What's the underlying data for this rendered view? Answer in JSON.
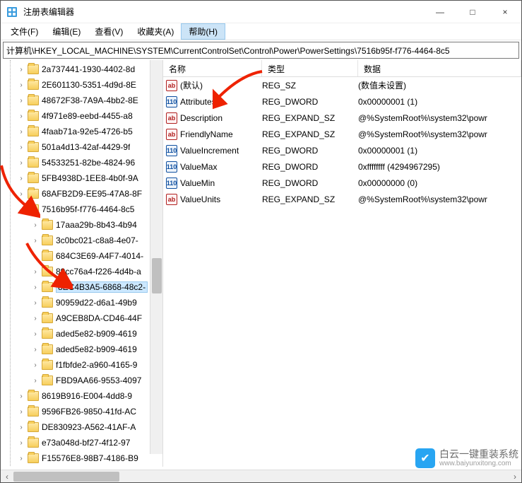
{
  "window": {
    "title": "注册表编辑器",
    "minimize": "—",
    "maximize": "□",
    "close": "×"
  },
  "menu": {
    "file": "文件(F)",
    "edit": "编辑(E)",
    "view": "查看(V)",
    "favorites": "收藏夹(A)",
    "help": "帮助(H)"
  },
  "address": "计算机\\HKEY_LOCAL_MACHINE\\SYSTEM\\CurrentControlSet\\Control\\Power\\PowerSettings\\7516b95f-f776-4464-8c5",
  "tree": {
    "level1": [
      "2a737441-1930-4402-8d",
      "2E601130-5351-4d9d-8E",
      "48672F38-7A9A-4bb2-8E",
      "4f971e89-eebd-4455-a8",
      "4faab71a-92e5-4726-b5",
      "501a4d13-42af-4429-9f",
      "54533251-82be-4824-96",
      "5FB4938D-1EE8-4b0f-9A",
      "68AFB2D9-EE95-47A8-8F",
      "7516b95f-f776-4464-8c5"
    ],
    "level2": [
      "17aaa29b-8b43-4b94",
      "3c0bc021-c8a8-4e07-",
      "684C3E69-A4F7-4014-",
      "89cc76a4-f226-4d4b-a",
      "8EC4B3A5-6868-48c2-",
      "90959d22-d6a1-49b9",
      "A9CEB8DA-CD46-44F",
      "aded5e82-b909-4619",
      "aded5e82-b909-4619",
      "f1fbfde2-a960-4165-9",
      "FBD9AA66-9553-4097"
    ],
    "level1_after": [
      "8619B916-E004-4dd8-9",
      "9596FB26-9850-41fd-AC",
      "DE830923-A562-41AF-A",
      "e73a048d-bf27-4f12-97",
      "F15576E8-98B7-4186-B9"
    ]
  },
  "columns": {
    "name": "名称",
    "type": "类型",
    "data": "数据"
  },
  "values": [
    {
      "icon": "sz",
      "name": "(默认)",
      "type": "REG_SZ",
      "data": "(数值未设置)"
    },
    {
      "icon": "dw",
      "name": "Attributes",
      "type": "REG_DWORD",
      "data": "0x00000001 (1)"
    },
    {
      "icon": "sz",
      "name": "Description",
      "type": "REG_EXPAND_SZ",
      "data": "@%SystemRoot%\\system32\\powr"
    },
    {
      "icon": "sz",
      "name": "FriendlyName",
      "type": "REG_EXPAND_SZ",
      "data": "@%SystemRoot%\\system32\\powr"
    },
    {
      "icon": "dw",
      "name": "ValueIncrement",
      "type": "REG_DWORD",
      "data": "0x00000001 (1)"
    },
    {
      "icon": "dw",
      "name": "ValueMax",
      "type": "REG_DWORD",
      "data": "0xffffffff (4294967295)"
    },
    {
      "icon": "dw",
      "name": "ValueMin",
      "type": "REG_DWORD",
      "data": "0x00000000 (0)"
    },
    {
      "icon": "sz",
      "name": "ValueUnits",
      "type": "REG_EXPAND_SZ",
      "data": "@%SystemRoot%\\system32\\powr"
    }
  ],
  "watermark": {
    "title": "白云一键重装系统",
    "sub": "www.baiyunxitong.com"
  }
}
